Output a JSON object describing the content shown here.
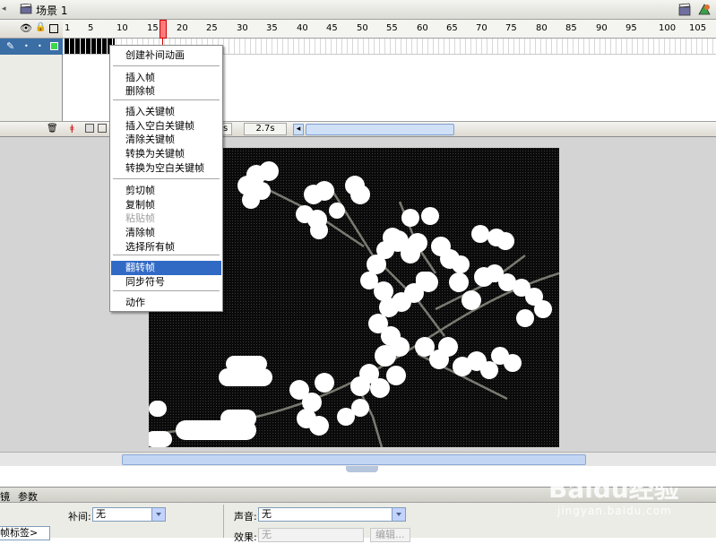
{
  "scene": {
    "name": "场景 1"
  },
  "timeline": {
    "ruler_numbers": [
      "1",
      "5",
      "10",
      "15",
      "20",
      "25",
      "30",
      "35",
      "40",
      "45",
      "50",
      "55",
      "60",
      "65",
      "70",
      "75",
      "80",
      "85",
      "90",
      "95",
      "100",
      "105"
    ],
    "current_frame": 16,
    "status": {
      "frame_rate": "s",
      "elapsed": "2.7s"
    }
  },
  "context_menu": {
    "items": [
      {
        "label": "创建补间动画"
      },
      {
        "label": "插入帧"
      },
      {
        "label": "删除帧"
      },
      {
        "label": "插入关键帧"
      },
      {
        "label": "插入空白关键帧"
      },
      {
        "label": "清除关键帧"
      },
      {
        "label": "转换为关键帧"
      },
      {
        "label": "转换为空白关键帧"
      },
      {
        "label": "剪切帧"
      },
      {
        "label": "复制帧"
      },
      {
        "label": "粘贴帧",
        "disabled": true
      },
      {
        "label": "清除帧"
      },
      {
        "label": "选择所有帧"
      },
      {
        "label": "翻转帧",
        "selected": true
      },
      {
        "label": "同步符号"
      },
      {
        "label": "动作"
      }
    ]
  },
  "properties": {
    "tabs": [
      "镜",
      "参数"
    ],
    "frame_label": "帧标签>",
    "tween_label": "补间:",
    "tween_value": "无",
    "sound_label": "声音:",
    "sound_value": "无",
    "effect_label": "效果:",
    "effect_value": "无",
    "edit_button": "编辑..."
  },
  "watermark": {
    "text": "Baidu经验",
    "url": "jingyan.baidu.com"
  },
  "colors": {
    "selection": "#316ac5",
    "layer_row": "#3a6ea5",
    "playhead": "#ff7b7b",
    "canvas": "#0a0a0a"
  }
}
